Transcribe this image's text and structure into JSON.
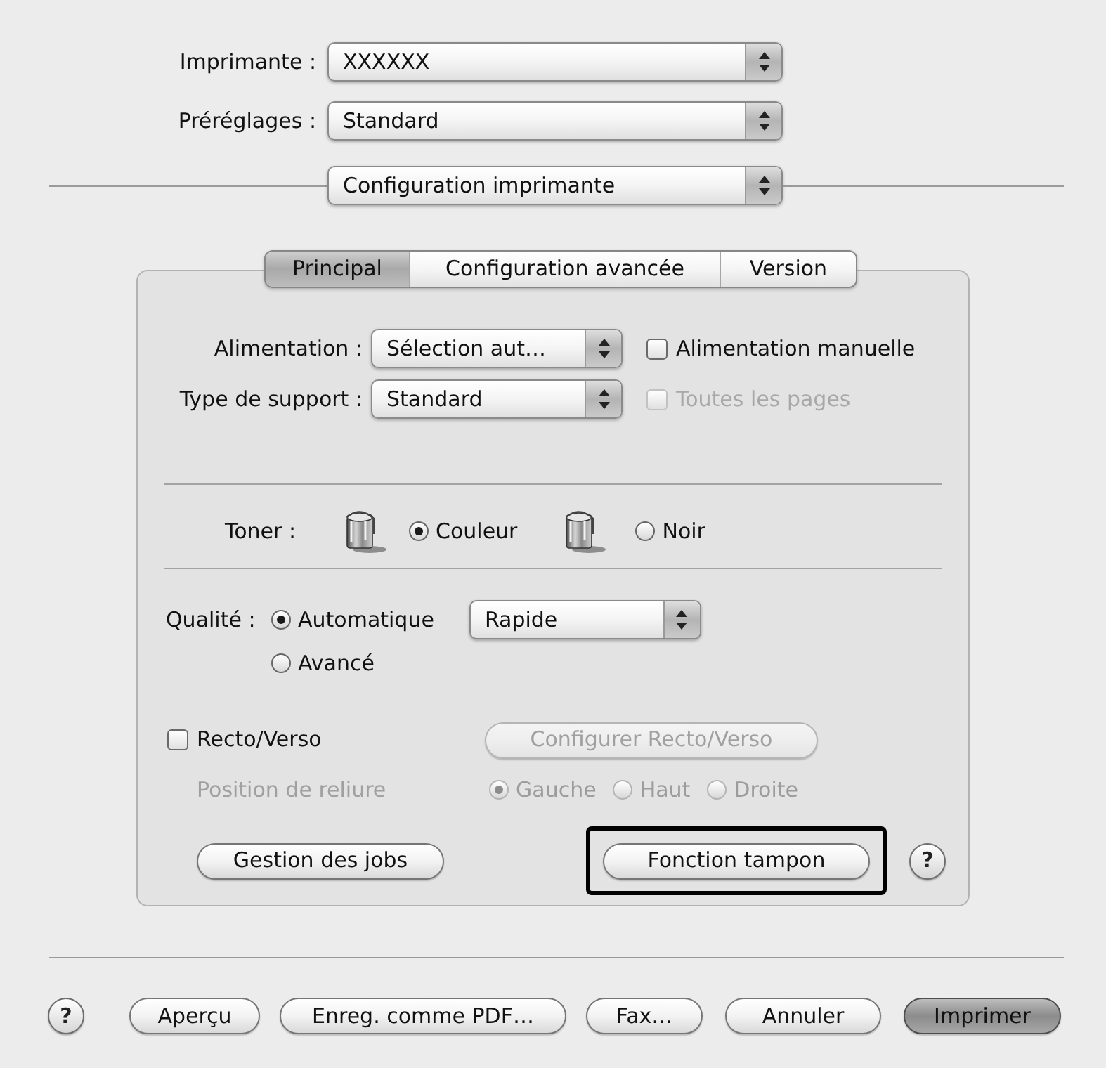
{
  "printer": {
    "label": "Imprimante :",
    "value": "XXXXXX"
  },
  "presets": {
    "label": "Préréglages :",
    "value": "Standard"
  },
  "panel_menu": {
    "value": "Configuration imprimante"
  },
  "tabs": [
    {
      "label": "Principal",
      "selected": true
    },
    {
      "label": "Configuration avancée",
      "selected": false
    },
    {
      "label": "Version",
      "selected": false
    }
  ],
  "settings": {
    "paper_source": {
      "label": "Alimentation :",
      "value": "Sélection aut…",
      "option": {
        "label": "Alimentation manuelle",
        "checked": false,
        "disabled": false
      }
    },
    "media_type": {
      "label": "Type de support :",
      "value": "Standard",
      "option": {
        "label": "Toutes les pages",
        "checked": false,
        "disabled": true
      }
    },
    "toner": {
      "label": "Toner :",
      "options": [
        {
          "label": "Couleur",
          "selected": true
        },
        {
          "label": "Noir",
          "selected": false
        }
      ]
    },
    "quality": {
      "label": "Qualité :",
      "options": [
        {
          "label": "Automatique",
          "selected": true
        },
        {
          "label": "Avancé",
          "selected": false
        }
      ],
      "preset": "Rapide"
    },
    "duplex": {
      "label": "Recto/Verso",
      "checked": false,
      "setup_button": {
        "label": "Configurer Recto/Verso",
        "disabled": true
      }
    },
    "binding": {
      "label": "Position de reliure",
      "disabled": true,
      "options": [
        {
          "label": "Gauche",
          "selected": true
        },
        {
          "label": "Haut",
          "selected": false
        },
        {
          "label": "Droite",
          "selected": false
        }
      ]
    },
    "buttons": [
      {
        "label": "Gestion des jobs",
        "highlighted": false
      },
      {
        "label": "Fonction tampon",
        "highlighted": true
      }
    ],
    "help": "?"
  },
  "footer": {
    "help": "?",
    "buttons": [
      {
        "label": "Aperçu",
        "default": false
      },
      {
        "label": "Enreg. comme PDF…",
        "default": false
      },
      {
        "label": "Fax…",
        "default": false
      },
      {
        "label": "Annuler",
        "default": false
      },
      {
        "label": "Imprimer",
        "default": true
      }
    ]
  }
}
